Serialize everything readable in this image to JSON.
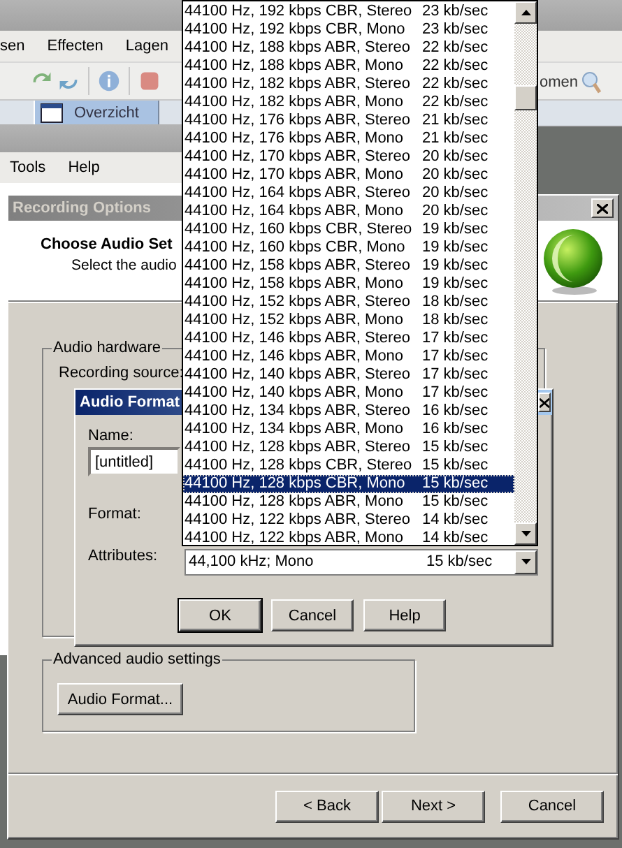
{
  "background_app": {
    "menu": [
      "sen",
      "Effecten",
      "Lagen"
    ],
    "toolbar_label": "omen",
    "tab": {
      "label": "Overzicht",
      "selected": true
    }
  },
  "second_app": {
    "menu": [
      "Tools",
      "Help"
    ]
  },
  "recording_options": {
    "title": "Recording Options",
    "heading": "Choose Audio Set",
    "subheading": "Select the audio",
    "audio_hardware": {
      "title": "Audio hardware",
      "source_label": "Recording source:"
    },
    "advanced": {
      "title": "Advanced audio settings",
      "button": "Audio Format..."
    },
    "buttons": [
      {
        "label": "< Back"
      },
      {
        "label": "Next >"
      },
      {
        "label": "Cancel"
      }
    ]
  },
  "audio_format": {
    "title": "Audio Format",
    "name_label": "Name:",
    "name_value": "[untitled]",
    "format_label": "Format:",
    "attributes_label": "Attributes:",
    "attributes": {
      "format": "44,100 kHz; Mono",
      "rate": "15 kb/sec"
    },
    "buttons": [
      {
        "label": "OK",
        "default": true
      },
      {
        "label": "Cancel",
        "default": false
      },
      {
        "label": "Help",
        "default": false
      }
    ]
  },
  "attributes_list": {
    "items": [
      {
        "format": "44100 Hz, 192 kbps CBR, Stereo",
        "rate": "23 kb/sec",
        "selected": false
      },
      {
        "format": "44100 Hz, 192 kbps CBR, Mono",
        "rate": "23 kb/sec",
        "selected": false
      },
      {
        "format": "44100 Hz, 188 kbps ABR, Stereo",
        "rate": "22 kb/sec",
        "selected": false
      },
      {
        "format": "44100 Hz, 188 kbps ABR, Mono",
        "rate": "22 kb/sec",
        "selected": false
      },
      {
        "format": "44100 Hz, 182 kbps ABR, Stereo",
        "rate": "22 kb/sec",
        "selected": false
      },
      {
        "format": "44100 Hz, 182 kbps ABR, Mono",
        "rate": "22 kb/sec",
        "selected": false
      },
      {
        "format": "44100 Hz, 176 kbps ABR, Stereo",
        "rate": "21 kb/sec",
        "selected": false
      },
      {
        "format": "44100 Hz, 176 kbps ABR, Mono",
        "rate": "21 kb/sec",
        "selected": false
      },
      {
        "format": "44100 Hz, 170 kbps ABR, Stereo",
        "rate": "20 kb/sec",
        "selected": false
      },
      {
        "format": "44100 Hz, 170 kbps ABR, Mono",
        "rate": "20 kb/sec",
        "selected": false
      },
      {
        "format": "44100 Hz, 164 kbps ABR, Stereo",
        "rate": "20 kb/sec",
        "selected": false
      },
      {
        "format": "44100 Hz, 164 kbps ABR, Mono",
        "rate": "20 kb/sec",
        "selected": false
      },
      {
        "format": "44100 Hz, 160 kbps CBR, Stereo",
        "rate": "19 kb/sec",
        "selected": false
      },
      {
        "format": "44100 Hz, 160 kbps CBR, Mono",
        "rate": "19 kb/sec",
        "selected": false
      },
      {
        "format": "44100 Hz, 158 kbps ABR, Stereo",
        "rate": "19 kb/sec",
        "selected": false
      },
      {
        "format": "44100 Hz, 158 kbps ABR, Mono",
        "rate": "19 kb/sec",
        "selected": false
      },
      {
        "format": "44100 Hz, 152 kbps ABR, Stereo",
        "rate": "18 kb/sec",
        "selected": false
      },
      {
        "format": "44100 Hz, 152 kbps ABR, Mono",
        "rate": "18 kb/sec",
        "selected": false
      },
      {
        "format": "44100 Hz, 146 kbps ABR, Stereo",
        "rate": "17 kb/sec",
        "selected": false
      },
      {
        "format": "44100 Hz, 146 kbps ABR, Mono",
        "rate": "17 kb/sec",
        "selected": false
      },
      {
        "format": "44100 Hz, 140 kbps ABR, Stereo",
        "rate": "17 kb/sec",
        "selected": false
      },
      {
        "format": "44100 Hz, 140 kbps ABR, Mono",
        "rate": "17 kb/sec",
        "selected": false
      },
      {
        "format": "44100 Hz, 134 kbps ABR, Stereo",
        "rate": "16 kb/sec",
        "selected": false
      },
      {
        "format": "44100 Hz, 134 kbps ABR, Mono",
        "rate": "16 kb/sec",
        "selected": false
      },
      {
        "format": "44100 Hz, 128 kbps ABR, Stereo",
        "rate": "15 kb/sec",
        "selected": false
      },
      {
        "format": "44100 Hz, 128 kbps CBR, Stereo",
        "rate": "15 kb/sec",
        "selected": false
      },
      {
        "format": "44100 Hz, 128 kbps CBR, Mono",
        "rate": "15 kb/sec",
        "selected": true
      },
      {
        "format": "44100 Hz, 128 kbps ABR, Mono",
        "rate": "15 kb/sec",
        "selected": false
      },
      {
        "format": "44100 Hz, 122 kbps ABR, Stereo",
        "rate": "14 kb/sec",
        "selected": false
      },
      {
        "format": "44100 Hz, 122 kbps ABR, Mono",
        "rate": "14 kb/sec",
        "selected": false
      }
    ]
  }
}
